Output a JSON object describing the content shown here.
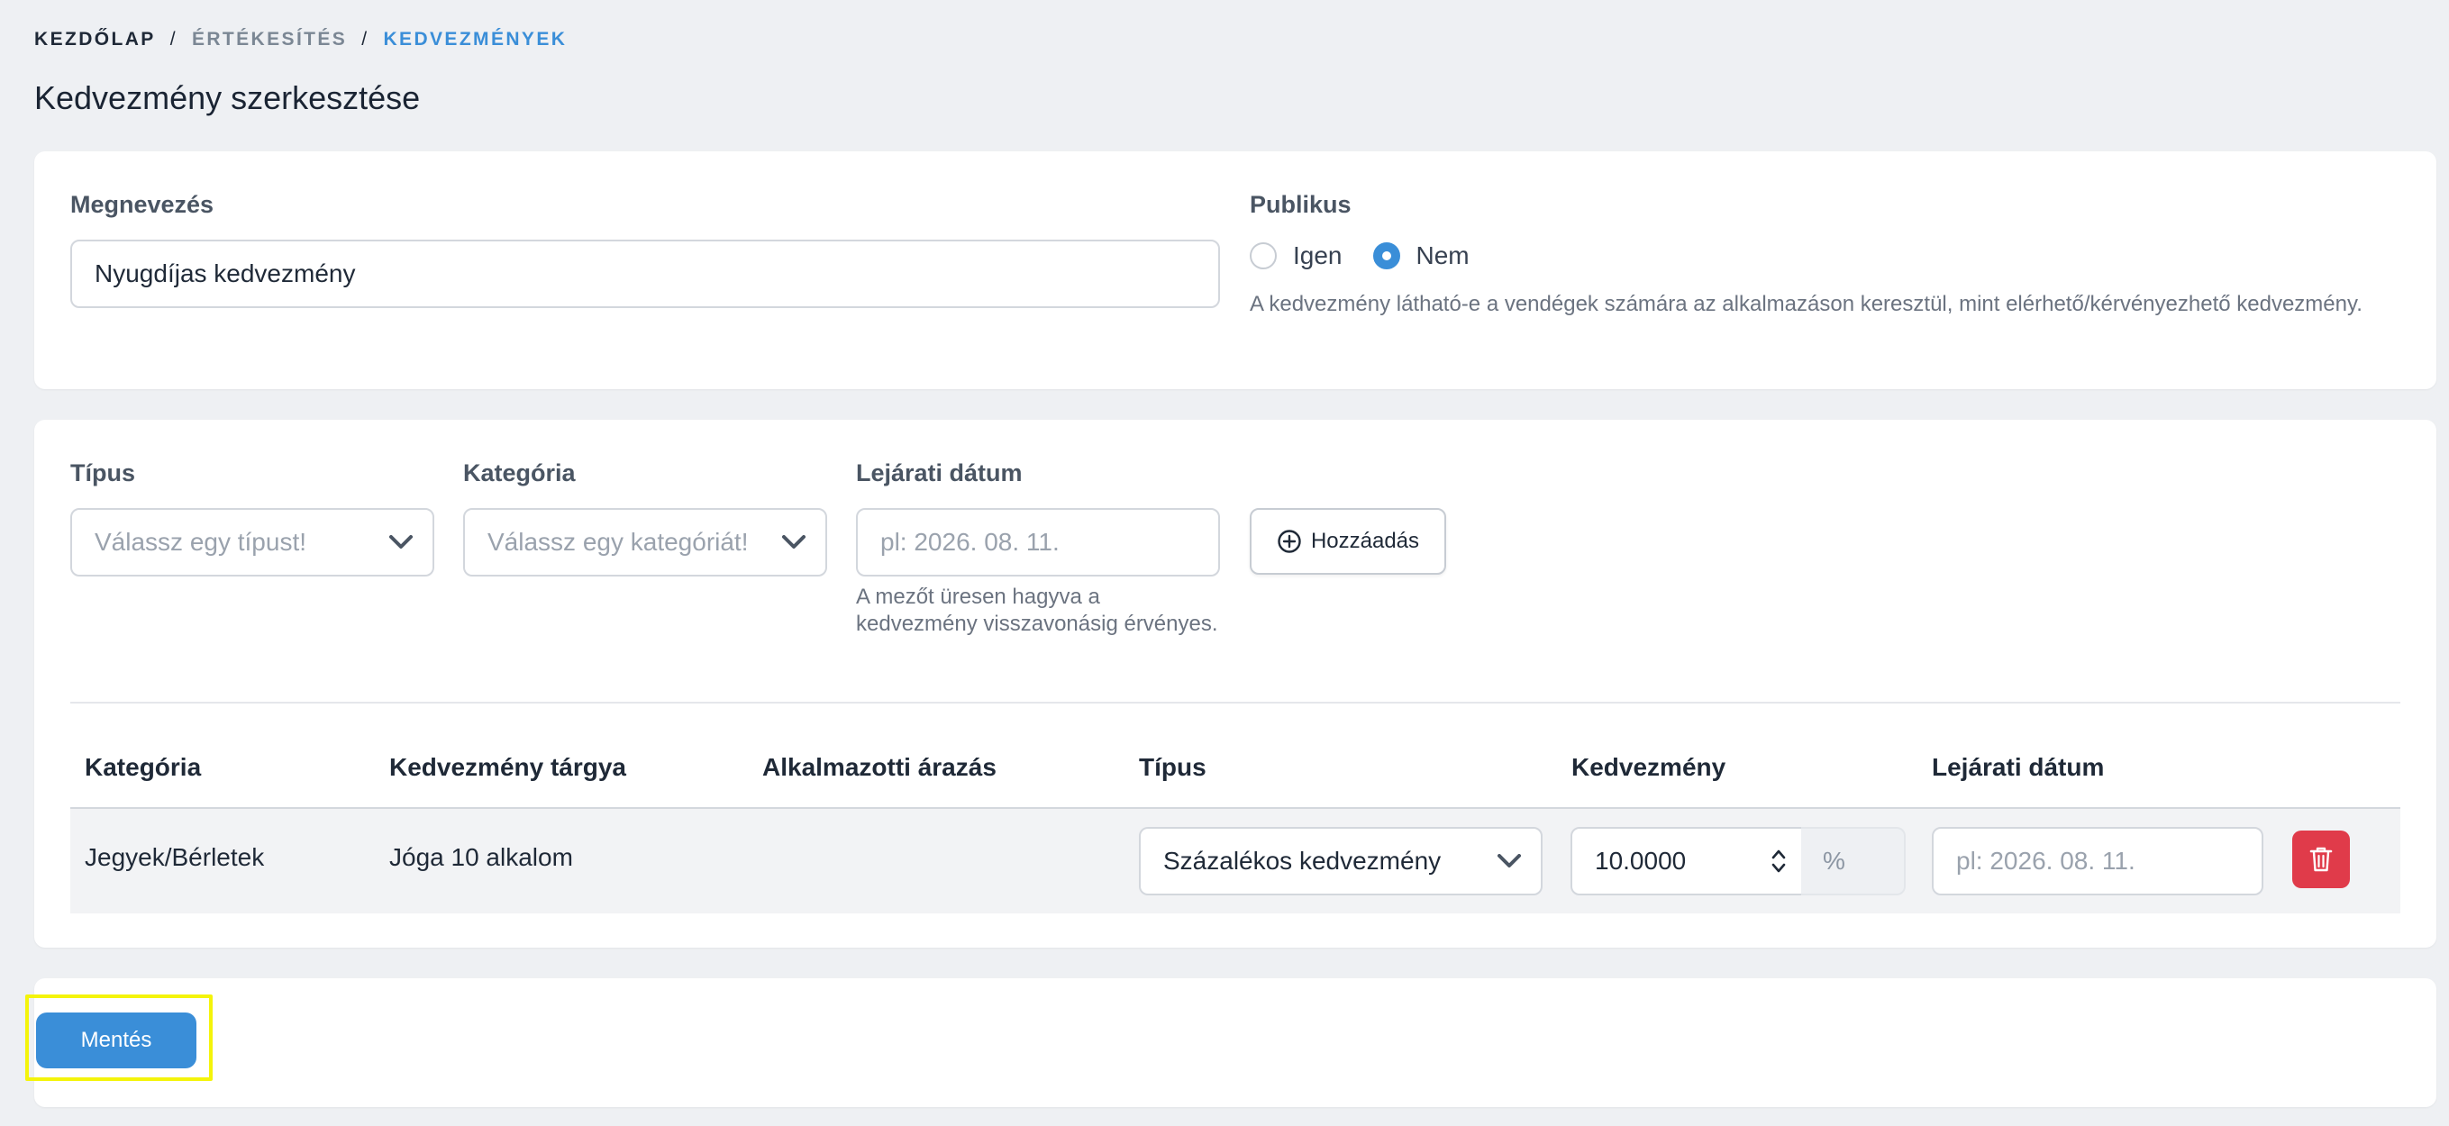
{
  "breadcrumb": {
    "home": "KEZDŐLAP",
    "sales": "ÉRTÉKESÍTÉS",
    "current": "KEDVEZMÉNYEK",
    "separator": "/"
  },
  "page_title": "Kedvezmény szerkesztése",
  "general": {
    "name_label": "Megnevezés",
    "name_value": "Nyugdíjas kedvezmény",
    "public_label": "Publikus",
    "public_options": [
      "Igen",
      "Nem"
    ],
    "public_selected": "Nem",
    "public_help": "A kedvezmény látható-e a vendégek számára az alkalmazáson keresztül, mint elérhető/kérvényezhető kedvezmény."
  },
  "add_form": {
    "type_label": "Típus",
    "type_placeholder": "Válassz egy típust!",
    "category_label": "Kategória",
    "category_placeholder": "Válassz egy kategóriát!",
    "expiry_label": "Lejárati dátum",
    "expiry_placeholder": "pl: 2026. 08. 11.",
    "expiry_help_1": "A mezőt üresen hagyva a",
    "expiry_help_2": "kedvezmény visszavonásig érvényes.",
    "add_button": "Hozzáadás"
  },
  "table": {
    "headers": [
      "Kategória",
      "Kedvezmény tárgya",
      "Alkalmazotti árazás",
      "Típus",
      "Kedvezmény",
      "Lejárati dátum"
    ],
    "rows": [
      {
        "category": "Jegyek/Bérletek",
        "subject": "Jóga 10 alkalom",
        "employee_pricing": "",
        "type": "Százalékos kedvezmény",
        "discount": "10.0000",
        "unit": "%",
        "expiry_placeholder": "pl: 2026. 08. 11."
      }
    ]
  },
  "actions": {
    "save": "Mentés"
  },
  "colors": {
    "accent": "#3a8ed8",
    "danger": "#e03b4a",
    "highlight": "#f4f40a"
  }
}
